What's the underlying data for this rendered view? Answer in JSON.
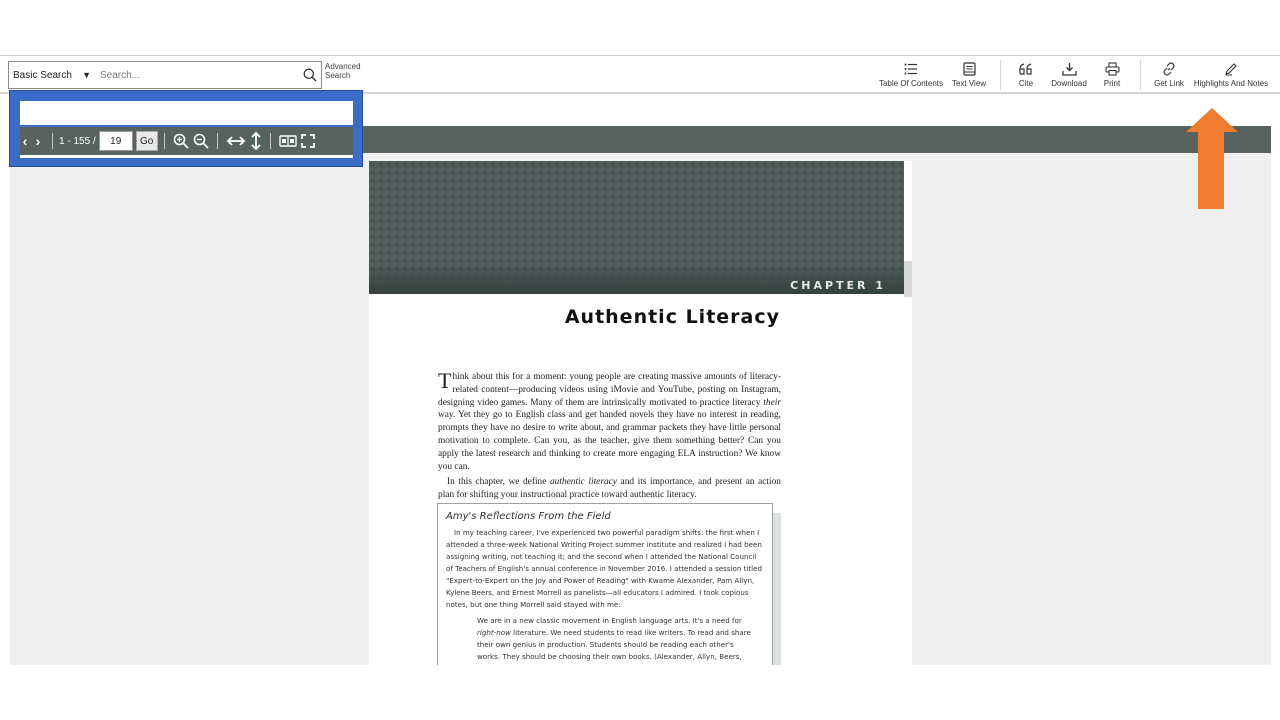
{
  "search": {
    "type_label": "Basic Search",
    "placeholder": "Search...",
    "advanced_label_1": "Advanced",
    "advanced_label_2": "Search"
  },
  "toolbar": {
    "toc": "Table Of Contents",
    "text_view": "Text View",
    "cite": "Cite",
    "download": "Download",
    "print": "Print",
    "get_link": "Get Link",
    "highlights": "Highlights And Notes"
  },
  "nav": {
    "page_range": "1 - 155 /",
    "current_page": "19",
    "go_label": "Go"
  },
  "page": {
    "chapter_label": "CHAPTER 1",
    "title": "Authentic Literacy",
    "dropcap": "T",
    "para1_before_em": "hink about this for a moment: young people are creating massive amounts of literacy-related content—producing videos using iMovie and YouTube, posting on Instagram, designing video games. Many of them are intrinsically motivated to practice literacy ",
    "para1_em": "their",
    "para1_after_em": " way. Yet they go to English class and get handed novels they have no interest in reading, prompts they have no desire to write about, and grammar packets they have little personal motivation to complete. Can you, as the teacher, give them something better? Can you apply the latest research and thinking to create more engaging ELA instruction? We know you can.",
    "para2_before_em": "In this chapter, we define ",
    "para2_em": "authentic literacy",
    "para2_after_em": " and its importance, and present an action plan for shifting your instructional practice toward authentic literacy.",
    "box_title": "Amy's Reflections From the Field",
    "box_text": "In my teaching career, I've experienced two powerful paradigm shifts: the first when I attended a three-week National Writing Project summer institute and realized I had been assigning writing, not teaching it; and the second when I attended the National Council of Teachers of English's annual conference in November 2016. I attended a session titled \"Expert-to-Expert on the Joy and Power of Reading\" with Kwame Alexander, Pam Allyn, Kylene Beers, and Ernest Morrell as panelists—all educators I admired. I took copious notes, but one thing Morrell said stayed with me:",
    "quote_before_em": "We are in a new classic movement in English language arts. It's a need for ",
    "quote_em": "right-now",
    "quote_after_em": " literature. We need students to read like writers. To read and share their own genius in production. Students should be reading each other's works. They should be choosing their own books. (Alexander, Allyn, Beers,"
  },
  "colors": {
    "nav_bar": "#58625f",
    "highlight_frame": "#3b6cc8",
    "arrow": "#ee7d31"
  }
}
